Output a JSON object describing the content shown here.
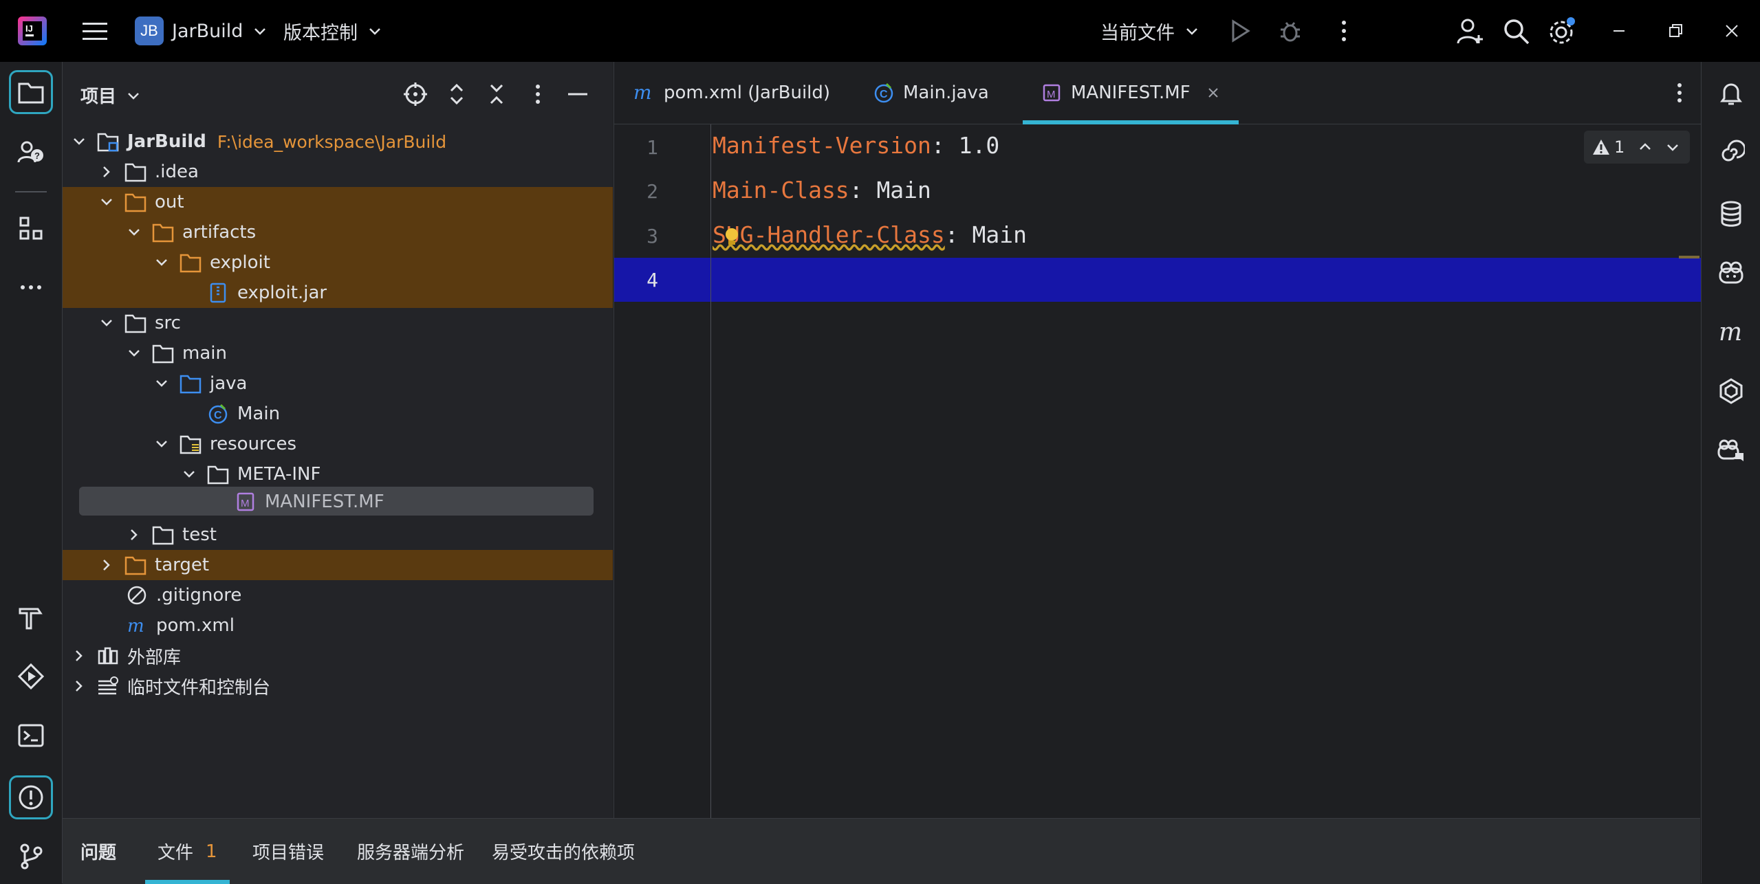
{
  "titlebar": {
    "project_badge": "JB",
    "project_name": "JarBuild",
    "vcs_label": "版本控制",
    "run_config": "当前文件"
  },
  "project_panel": {
    "title": "项目",
    "tree": [
      {
        "label": "JarBuild",
        "path": "F:\\idea_workspace\\JarBuild"
      },
      {
        "label": ".idea"
      },
      {
        "label": "out"
      },
      {
        "label": "artifacts"
      },
      {
        "label": "exploit"
      },
      {
        "label": "exploit.jar"
      },
      {
        "label": "src"
      },
      {
        "label": "main"
      },
      {
        "label": "java"
      },
      {
        "label": "Main"
      },
      {
        "label": "resources"
      },
      {
        "label": "META-INF"
      },
      {
        "label": "MANIFEST.MF"
      },
      {
        "label": "test"
      },
      {
        "label": "target"
      },
      {
        "label": ".gitignore"
      },
      {
        "label": "pom.xml"
      },
      {
        "label": "外部库"
      },
      {
        "label": "临时文件和控制台"
      }
    ]
  },
  "editor": {
    "tabs": [
      {
        "label": "pom.xml (JarBuild)"
      },
      {
        "label": "Main.java"
      },
      {
        "label": "MANIFEST.MF"
      }
    ],
    "lines": [
      {
        "num": "1",
        "key": "Manifest-Version",
        "sep": ": ",
        "value": "1.0"
      },
      {
        "num": "2",
        "key": "Main-Class",
        "sep": ": ",
        "value": "Main"
      },
      {
        "num": "3",
        "key": "SUG-Handler-Class",
        "sep": ": ",
        "value": "Main"
      },
      {
        "num": "4",
        "key": "",
        "sep": "",
        "value": ""
      }
    ],
    "inspection_count": "1"
  },
  "bottom_bar": {
    "tabs": [
      {
        "label": "问题"
      },
      {
        "label": "文件",
        "count": "1"
      },
      {
        "label": "项目错误"
      },
      {
        "label": "服务器端分析"
      },
      {
        "label": "易受攻击的依赖项"
      }
    ]
  },
  "colors": {
    "accent": "#35b4d3",
    "excluded_highlight": "#5a3a10",
    "manifest_key": "#e8773e",
    "caret_line": "#1616a8"
  }
}
